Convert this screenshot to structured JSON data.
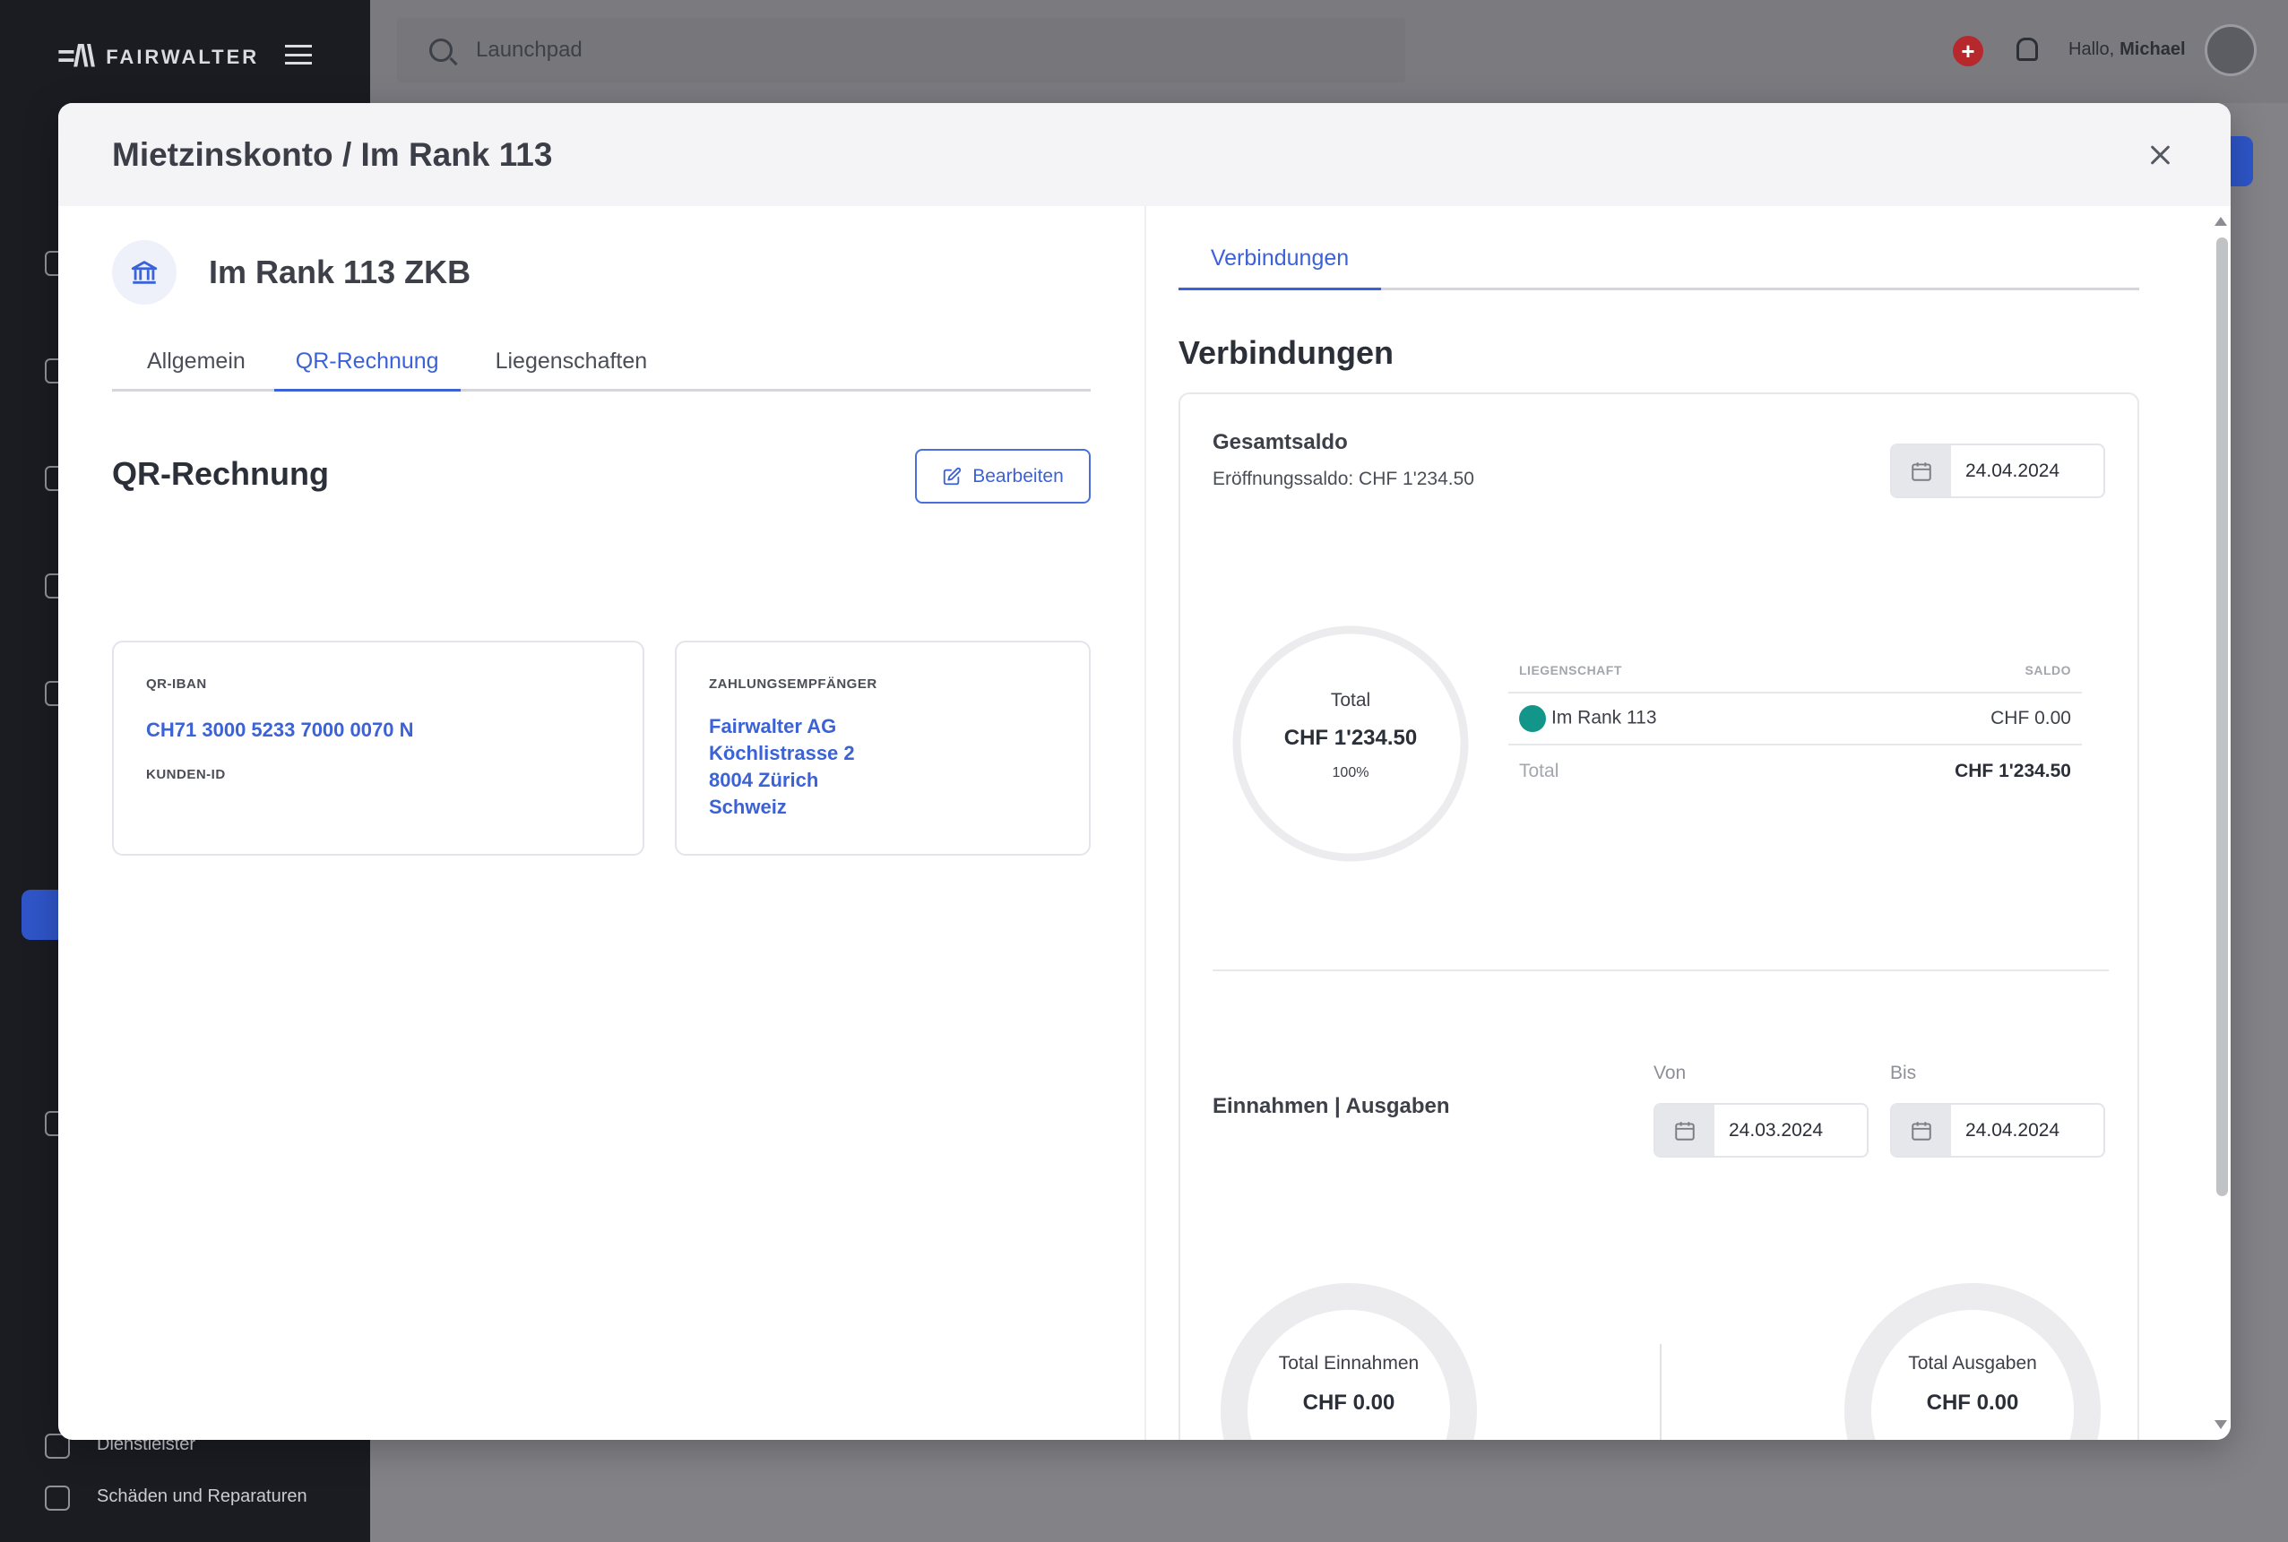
{
  "app": {
    "brand": "FAIRWALTER",
    "search_placeholder": "Launchpad",
    "greeting_prefix": "Hallo,",
    "user_name": "Michael",
    "sidebar_items": [
      "Dienstleister",
      "Schäden und Reparaturen"
    ]
  },
  "modal": {
    "title": "Mietzinskonto / Im Rank 113",
    "close_label": "×"
  },
  "account": {
    "name": "Im Rank 113 ZKB",
    "tabs": [
      "Allgemein",
      "QR-Rechnung",
      "Liegenschaften"
    ],
    "active_tab": "QR-Rechnung"
  },
  "qr": {
    "section_title": "QR-Rechnung",
    "edit_label": "Bearbeiten",
    "iban_label": "QR-IBAN",
    "iban_value": "CH71 3000 5233 7000 0070 N",
    "customer_id_label": "KUNDEN-ID",
    "payee_label": "ZAHLUNGSEMPFÄNGER",
    "payee_lines": [
      "Fairwalter AG",
      "Köchlistrasse 2",
      "8004 Zürich",
      "Schweiz"
    ]
  },
  "connections": {
    "tab_label": "Verbindungen",
    "section_title": "Verbindungen",
    "total_balance_title": "Gesamtsaldo",
    "opening_balance": "Eröffnungssaldo: CHF 1'234.50",
    "balance_date": "24.04.2024",
    "donut": {
      "label": "Total",
      "amount": "CHF 1'234.50",
      "percent": "100%"
    },
    "table": {
      "col_property": "LIEGENSCHAFT",
      "col_balance": "SALDO",
      "rows": [
        {
          "property": "Im Rank 113",
          "balance": "CHF 0.00",
          "color": "#12968a"
        }
      ],
      "total_label": "Total",
      "total_value": "CHF 1'234.50"
    },
    "income_expense_title": "Einnahmen | Ausgaben",
    "from_label": "Von",
    "from_date": "24.03.2024",
    "to_label": "Bis",
    "to_date": "24.04.2024",
    "income_label": "Total Einnahmen",
    "income_amount": "CHF 0.00",
    "expense_label": "Total Ausgaben",
    "expense_amount": "CHF 0.00"
  },
  "colors": {
    "accent": "#3b62d6",
    "teal": "#12968a",
    "header_bg": "#f4f3f6"
  }
}
